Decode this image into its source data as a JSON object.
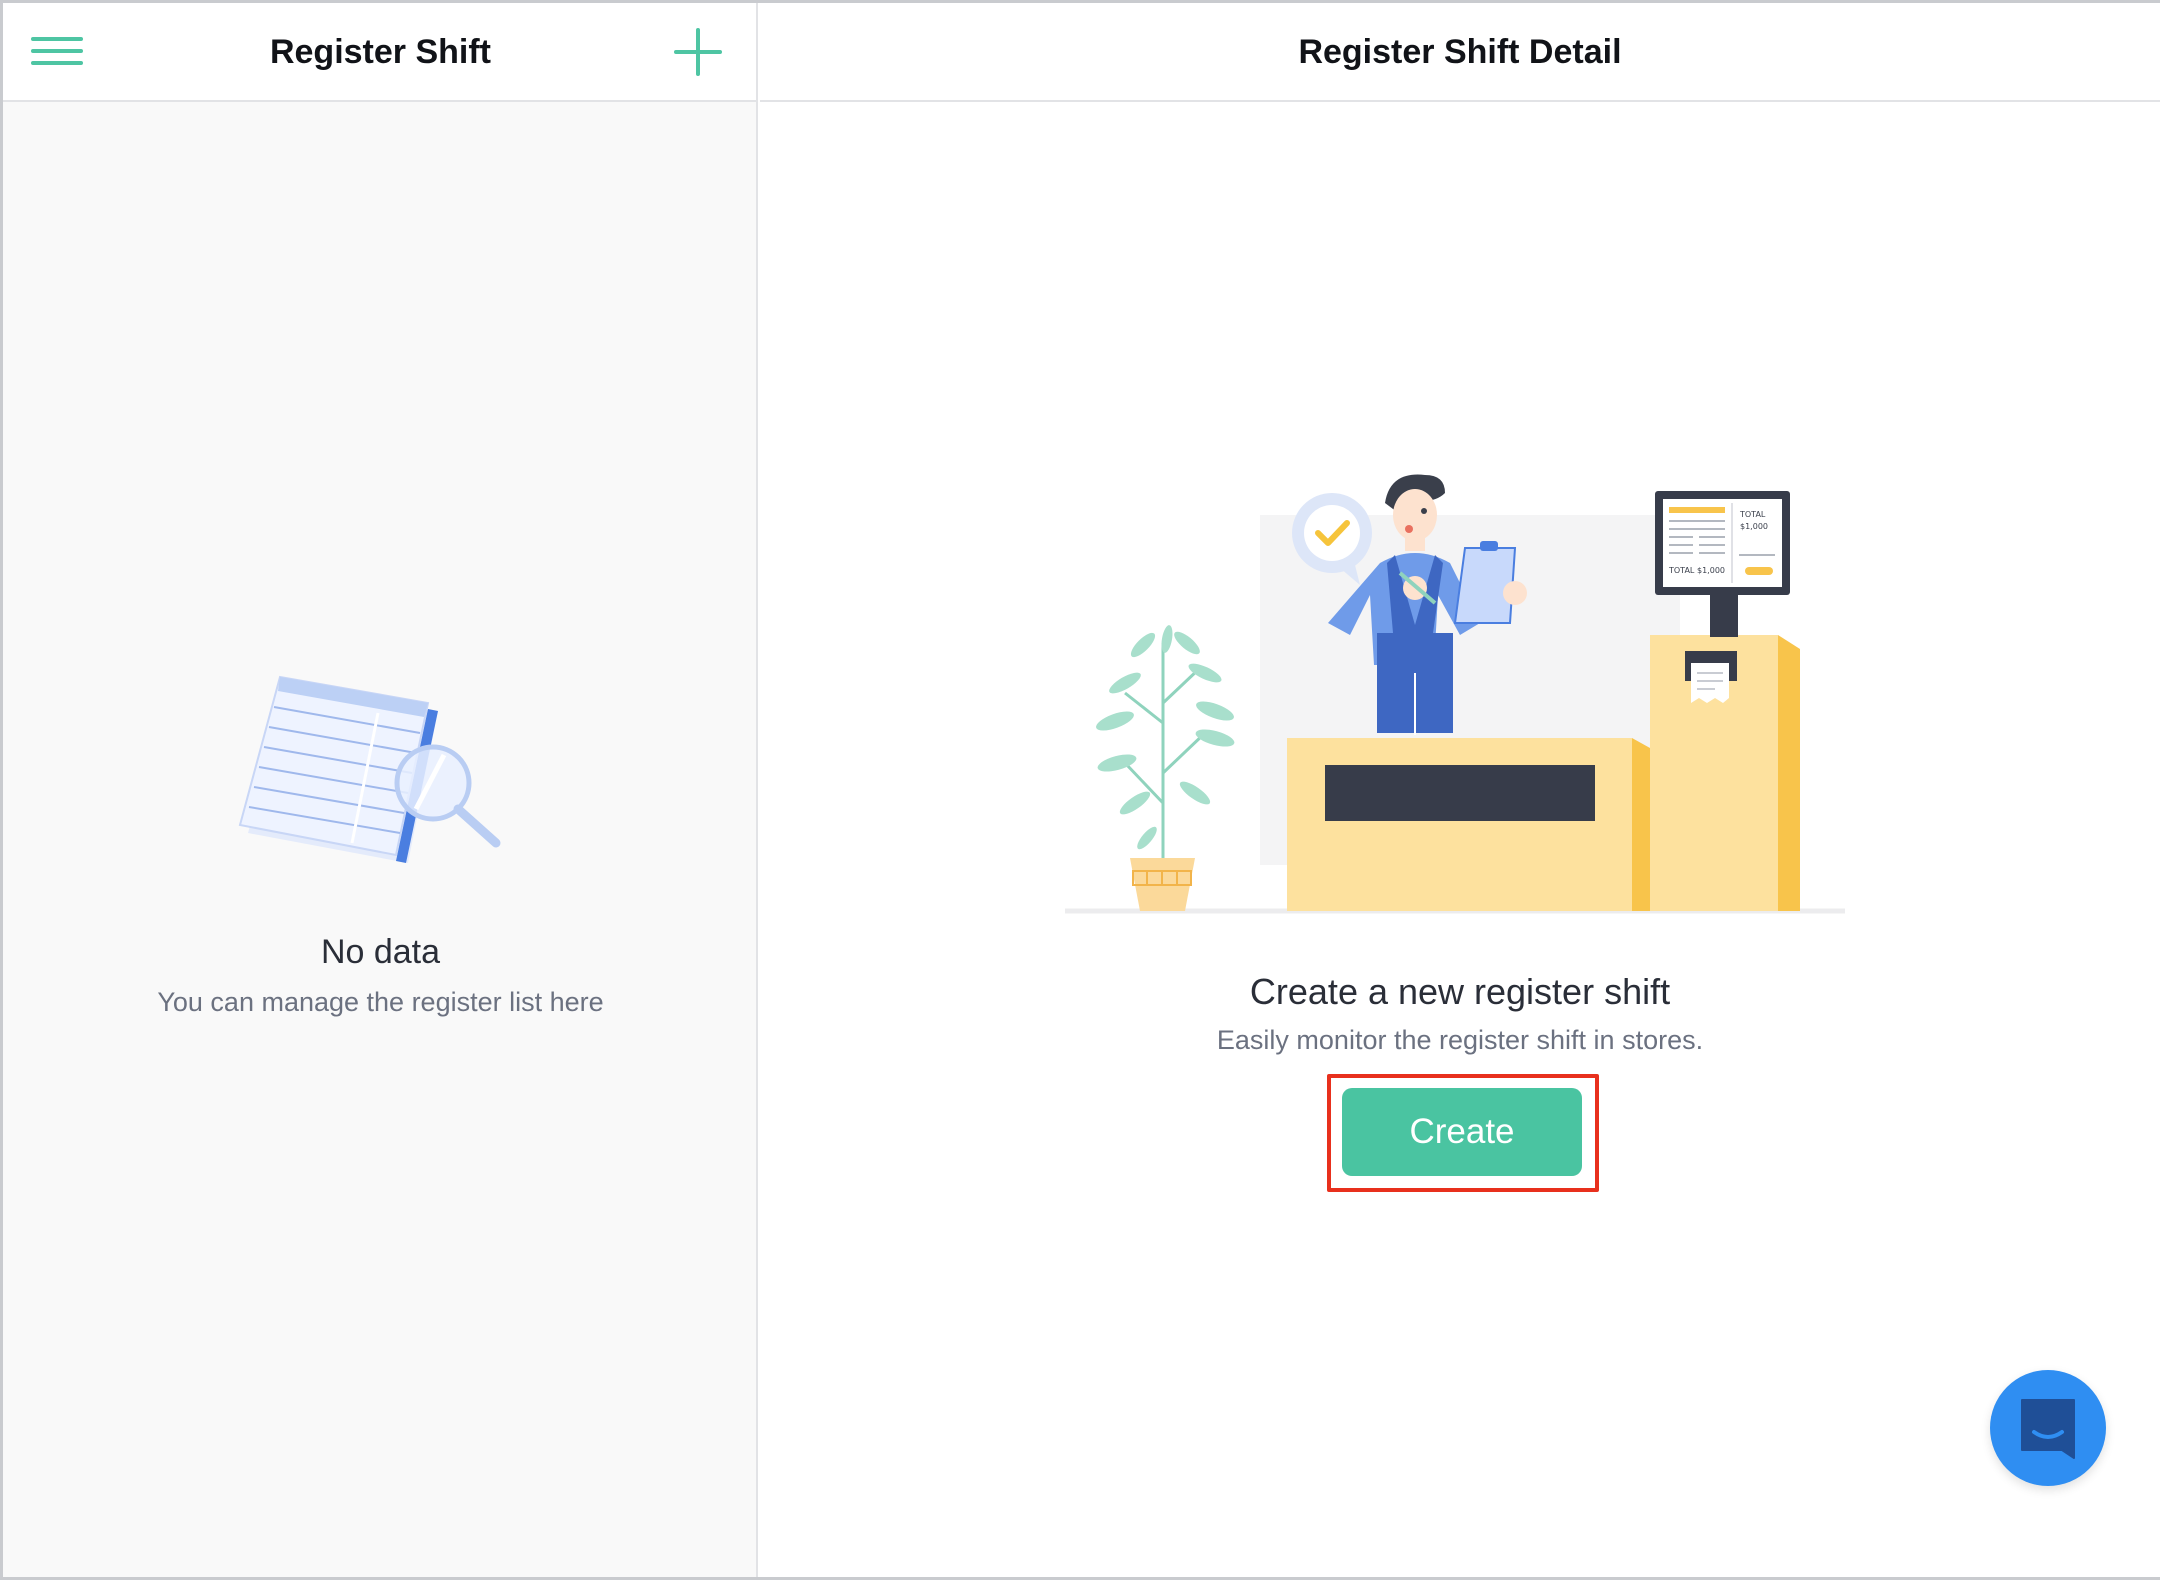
{
  "left_panel": {
    "title": "Register Shift",
    "menu_icon": "hamburger-menu-icon",
    "add_icon": "plus-icon",
    "empty_state": {
      "title": "No data",
      "subtitle": "You can manage the register list here",
      "illustration": "document-search-illustration"
    }
  },
  "right_panel": {
    "title": "Register Shift Detail",
    "empty_state": {
      "title": "Create a new register shift",
      "subtitle": "Easily monitor the register shift in stores.",
      "illustration": "cashier-register-illustration",
      "receipt": {
        "total_label_1": "TOTAL",
        "amount_1": "$1,000",
        "total_label_2": "TOTAL",
        "amount_2": "$1,000"
      }
    },
    "create_button_label": "Create"
  },
  "chat_button": {
    "icon": "chat-bubble-icon"
  },
  "colors": {
    "accent": "#4ac4a1",
    "highlight": "#e8301d",
    "chat": "#2f8ef2"
  }
}
